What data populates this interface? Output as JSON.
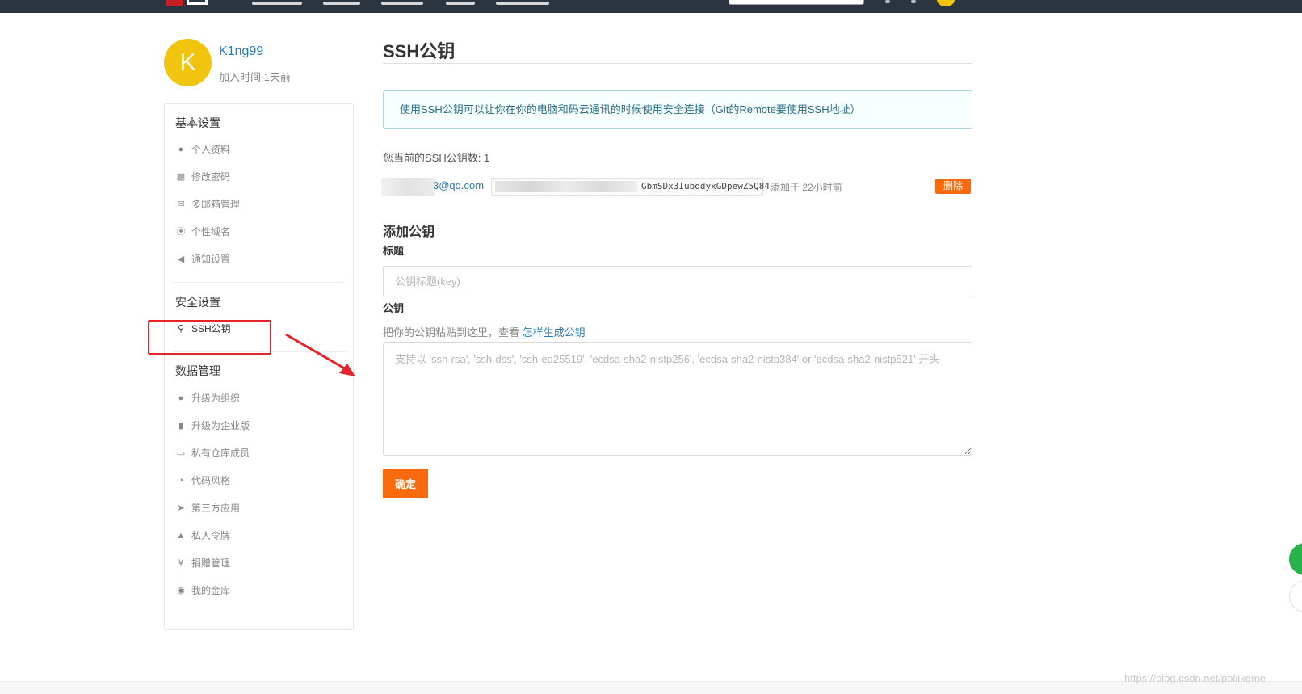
{
  "profile": {
    "avatar_letter": "K",
    "username": "K1ng99",
    "joined": "加入时间 1天前"
  },
  "sidebar": {
    "basic_title": "基本设置",
    "basic_items": [
      {
        "label": "个人资料",
        "icon": "user-icon"
      },
      {
        "label": "修改密码",
        "icon": "lock-icon"
      },
      {
        "label": "多邮箱管理",
        "icon": "envelope-icon"
      },
      {
        "label": "个性域名",
        "icon": "compass-icon"
      },
      {
        "label": "通知设置",
        "icon": "volume-icon"
      }
    ],
    "security_title": "安全设置",
    "security_items": [
      {
        "label": "SSH公钥",
        "icon": "key-icon"
      }
    ],
    "data_title": "数据管理",
    "data_items": [
      {
        "label": "升级为组织",
        "icon": "users-icon"
      },
      {
        "label": "升级为企业版",
        "icon": "building-icon"
      },
      {
        "label": "私有仓库成员",
        "icon": "book-icon"
      },
      {
        "label": "代码风格",
        "icon": "dashboard-icon"
      },
      {
        "label": "第三方应用",
        "icon": "rocket-icon"
      },
      {
        "label": "私人令牌",
        "icon": "incognito-icon"
      },
      {
        "label": "捐赠管理",
        "icon": "yen-icon"
      },
      {
        "label": "我的金库",
        "icon": "coins-icon"
      }
    ]
  },
  "main": {
    "title": "SSH公钥",
    "info": "使用SSH公钥可以让你在你的电脑和码云通讯的时候使用安全连接（Git的Remote要使用SSH地址）",
    "count_label": "您当前的SSH公钥数: 1",
    "key": {
      "email": "3@qq.com",
      "fingerprint": "GbmSDx3IubqdyxGDpewZ5Q84",
      "added": "添加于 22小时前",
      "delete_label": "删除"
    },
    "add_title": "添加公钥",
    "title_label": "标题",
    "title_placeholder": "公钥标题(key)",
    "key_label": "公钥",
    "hint_text": "把你的公钥粘贴到这里，查看 ",
    "hint_link": "怎样生成公钥",
    "key_placeholder": "支持以 'ssh-rsa', 'ssh-dss', 'ssh-ed25519', 'ecdsa-sha2-nistp256', 'ecdsa-sha2-nistp384' or 'ecdsa-sha2-nistp521' 开头",
    "submit_label": "确定"
  },
  "watermark": "https://blog.csdn.net/poliikeme",
  "colors": {
    "accent": "#f96a0e",
    "link": "#2c7bb4",
    "avatar": "#f1c40f",
    "highlight": "#e5232a"
  }
}
